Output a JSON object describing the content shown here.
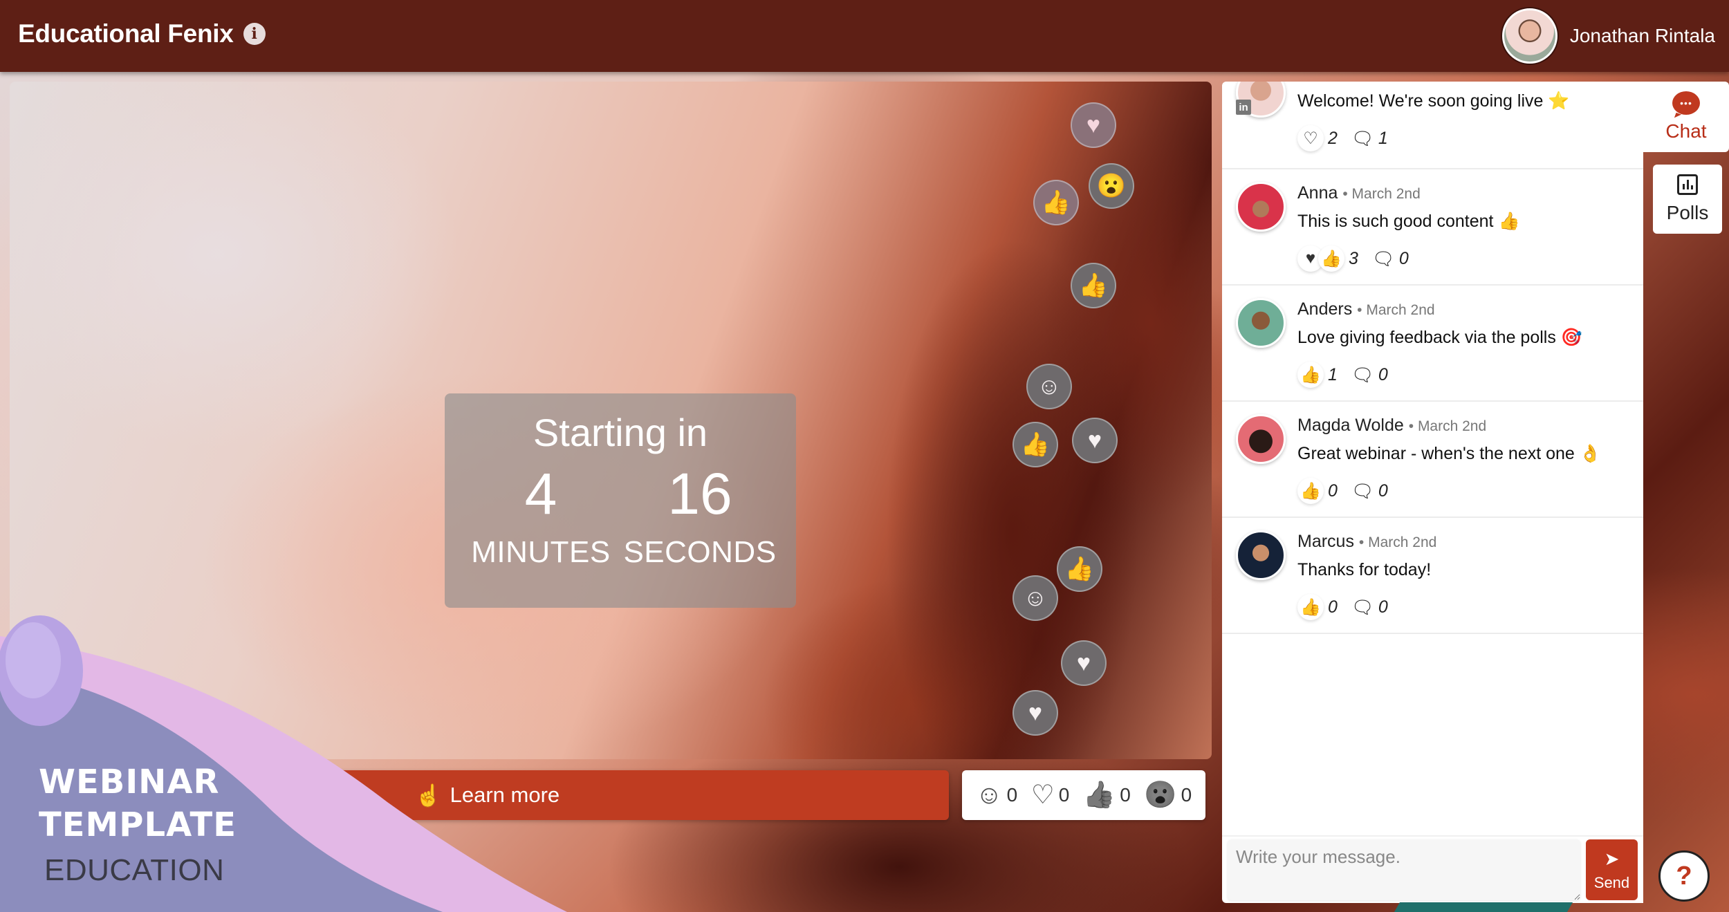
{
  "header": {
    "title": "Educational Fenix",
    "info_icon": "info-icon",
    "user_name": "Jonathan Rintala"
  },
  "countdown": {
    "title": "Starting in",
    "minutes": "4",
    "minutes_label": "MINUTES",
    "seconds": "16",
    "seconds_label": "SECONDS"
  },
  "floating_reactions": [
    "heart",
    "thumbs-up",
    "surprised",
    "thumbs-up",
    "smile",
    "thumbs-up",
    "heart",
    "thumbs-up",
    "smile",
    "heart",
    "heart"
  ],
  "learn_more": {
    "label": "Learn more",
    "icon": "hand-pointer-icon"
  },
  "reactions": [
    {
      "name": "smile",
      "glyph": "☺",
      "count": "0"
    },
    {
      "name": "heart",
      "glyph": "♡",
      "count": "0"
    },
    {
      "name": "thumbs-up",
      "glyph": "👍",
      "count": "0"
    },
    {
      "name": "surprised",
      "glyph": "😮",
      "count": "0"
    }
  ],
  "badge": {
    "line1": "WEBINAR",
    "line2": "TEMPLATE",
    "line3": "EDUCATION"
  },
  "chat": {
    "messages": [
      {
        "author": "",
        "date": "",
        "text": "Welcome! We're soon going live ⭐",
        "reactions": [
          "heart"
        ],
        "reaction_count": "2",
        "comment_count": "1",
        "avatar_color": "#f1d4d0",
        "linkedin": "in"
      },
      {
        "author": "Anna",
        "date": "March 2nd",
        "text": "This is such good content 👍",
        "reactions": [
          "heart-filled",
          "thumbs-up"
        ],
        "reaction_count": "3",
        "comment_count": "0",
        "avatar_color": "#d9334a"
      },
      {
        "author": "Anders",
        "date": "March 2nd",
        "text": "Love giving feedback via the polls 🎯",
        "reactions": [
          "thumbs-up"
        ],
        "reaction_count": "1",
        "comment_count": "0",
        "avatar_color": "#6fae97"
      },
      {
        "author": "Magda Wolde",
        "date": "March 2nd",
        "text": "Great webinar - when's the next one 👌",
        "reactions": [
          "thumbs-up"
        ],
        "reaction_count": "0",
        "comment_count": "0",
        "avatar_color": "#e46b74"
      },
      {
        "author": "Marcus",
        "date": "March 2nd",
        "text": "Thanks for today!",
        "reactions": [
          "thumbs-up"
        ],
        "reaction_count": "0",
        "comment_count": "0",
        "avatar_color": "#152238"
      }
    ],
    "input_placeholder": "Write your message.",
    "send_label": "Send"
  },
  "tabs": {
    "chat_label": "Chat",
    "polls_label": "Polls"
  },
  "help": {
    "label": "?"
  },
  "colors": {
    "header_bg": "#5e1f15",
    "accent": "#c0391f",
    "badge_purple": "#8c8dbd",
    "badge_pink": "#e3b8e6"
  }
}
